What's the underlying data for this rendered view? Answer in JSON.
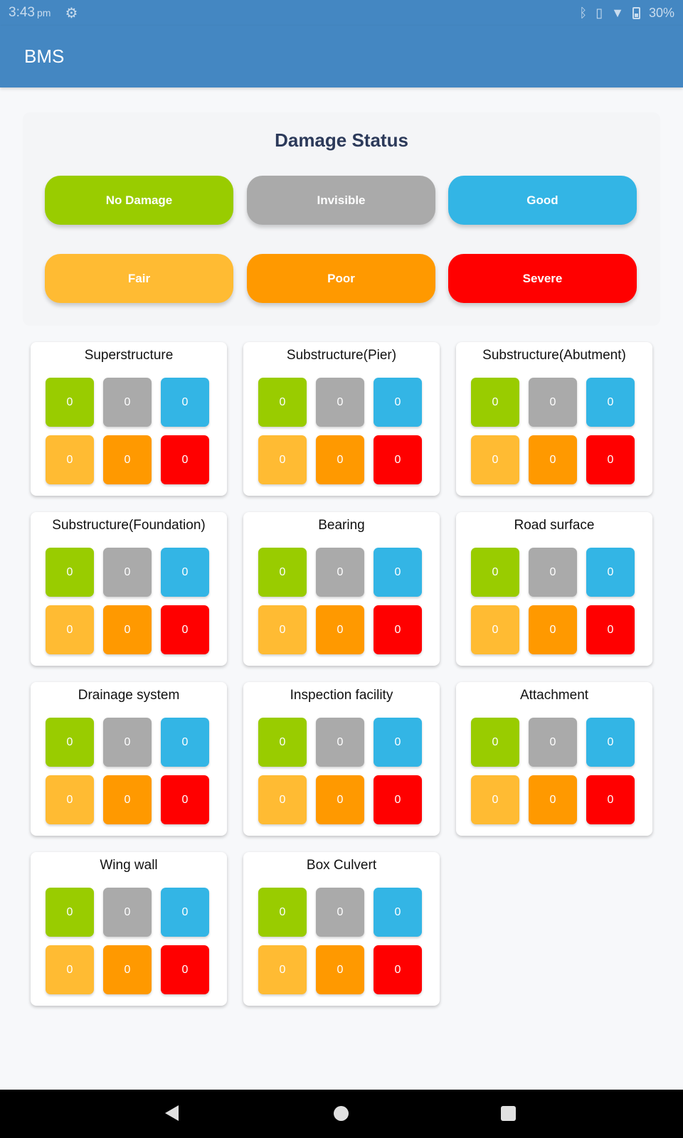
{
  "status_bar": {
    "time": "3:43",
    "ampm": "pm",
    "battery": "30%"
  },
  "app": {
    "title": "BMS"
  },
  "legend": {
    "title": "Damage Status",
    "items": [
      {
        "label": "No Damage",
        "color": "#99cc00"
      },
      {
        "label": "Invisible",
        "color": "#aaaaaa"
      },
      {
        "label": "Good",
        "color": "#33b5e5"
      },
      {
        "label": "Fair",
        "color": "#ffbb33"
      },
      {
        "label": "Poor",
        "color": "#ff9900"
      },
      {
        "label": "Severe",
        "color": "#ff0000"
      }
    ]
  },
  "components": [
    {
      "name": "Superstructure",
      "counts": [
        "0",
        "0",
        "0",
        "0",
        "0",
        "0"
      ]
    },
    {
      "name": "Substructure(Pier)",
      "counts": [
        "0",
        "0",
        "0",
        "0",
        "0",
        "0"
      ]
    },
    {
      "name": "Substructure(Abutment)",
      "counts": [
        "0",
        "0",
        "0",
        "0",
        "0",
        "0"
      ]
    },
    {
      "name": "Substructure(Foundation)",
      "counts": [
        "0",
        "0",
        "0",
        "0",
        "0",
        "0"
      ]
    },
    {
      "name": "Bearing",
      "counts": [
        "0",
        "0",
        "0",
        "0",
        "0",
        "0"
      ]
    },
    {
      "name": "Road surface",
      "counts": [
        "0",
        "0",
        "0",
        "0",
        "0",
        "0"
      ]
    },
    {
      "name": "Drainage system",
      "counts": [
        "0",
        "0",
        "0",
        "0",
        "0",
        "0"
      ]
    },
    {
      "name": "Inspection facility",
      "counts": [
        "0",
        "0",
        "0",
        "0",
        "0",
        "0"
      ]
    },
    {
      "name": "Attachment",
      "counts": [
        "0",
        "0",
        "0",
        "0",
        "0",
        "0"
      ]
    },
    {
      "name": "Wing wall",
      "counts": [
        "0",
        "0",
        "0",
        "0",
        "0",
        "0"
      ]
    },
    {
      "name": "Box Culvert",
      "counts": [
        "0",
        "0",
        "0",
        "0",
        "0",
        "0"
      ]
    }
  ],
  "icons": {
    "settings": "gear-icon",
    "bluetooth": "bluetooth-icon",
    "vibrate": "vibrate-icon",
    "wifi": "wifi-icon",
    "battery": "battery-icon",
    "nav_back": "back-icon",
    "nav_home": "home-icon",
    "nav_recent": "recent-apps-icon"
  }
}
